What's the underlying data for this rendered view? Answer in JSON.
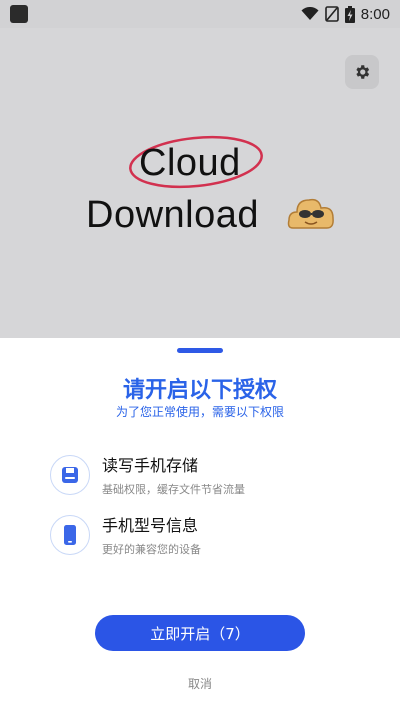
{
  "status_bar": {
    "time": "8:00",
    "icons": [
      "wifi-icon",
      "no-sim-icon",
      "battery-charging-icon"
    ]
  },
  "splash": {
    "brand_line1": "Cloud",
    "brand_line2": "Download",
    "settings_icon": "gear-icon",
    "mascot": "cloud-mascot-with-sunglasses"
  },
  "sheet": {
    "title": "请开启以下授权",
    "subtitle": "为了您正常使用，需要以下权限",
    "permissions": [
      {
        "icon": "storage-icon",
        "title": "读写手机存储",
        "desc": "基础权限，缓存文件节省流量"
      },
      {
        "icon": "phone-icon",
        "title": "手机型号信息",
        "desc": "更好的兼容您的设备"
      }
    ],
    "primary_button": "立即开启（7）",
    "cancel": "取消"
  },
  "colors": {
    "accent": "#2b55e6",
    "splash_bg": "#d6d6d8",
    "ring": "#d2314f"
  }
}
